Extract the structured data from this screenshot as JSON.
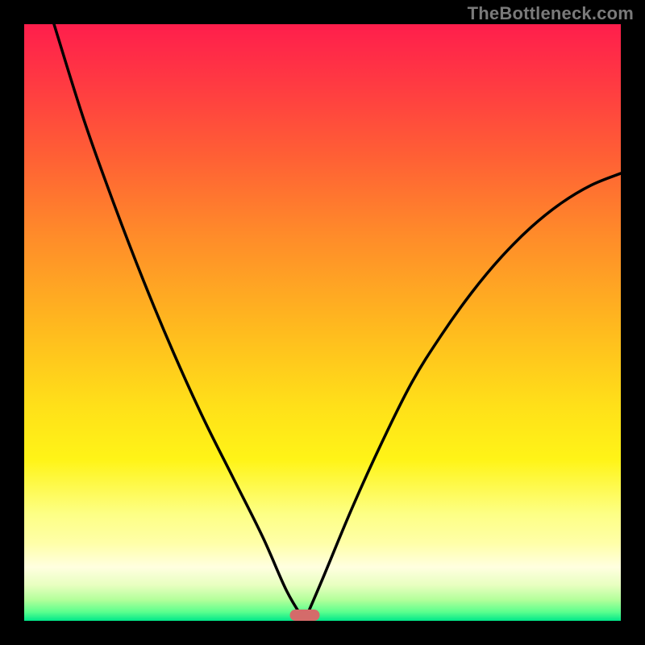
{
  "watermark": "TheBottleneck.com",
  "colors": {
    "frame": "#000000",
    "curve": "#000000",
    "marker": "#d46b6a",
    "gradient_stops": [
      "#ff1e4c",
      "#ff3a42",
      "#ff5f35",
      "#ff8a2a",
      "#ffb71f",
      "#ffe019",
      "#fff417",
      "#fdff84",
      "#ffffa8",
      "#ffffe0",
      "#e8ffc0",
      "#b2ff9a",
      "#5cff8e",
      "#00e78a"
    ]
  },
  "chart_data": {
    "type": "line",
    "title": "",
    "xlabel": "",
    "ylabel": "",
    "xlim": [
      0,
      100
    ],
    "ylim": [
      0,
      100
    ],
    "grid": false,
    "marker": {
      "x": 47,
      "width": 5
    },
    "series": [
      {
        "name": "left-curve",
        "x": [
          5,
          10,
          15,
          20,
          25,
          30,
          35,
          40,
          44,
          47
        ],
        "values": [
          100,
          84,
          70,
          57,
          45,
          34,
          24,
          14,
          5,
          0
        ]
      },
      {
        "name": "right-curve",
        "x": [
          47,
          50,
          55,
          60,
          65,
          70,
          75,
          80,
          85,
          90,
          95,
          100
        ],
        "values": [
          0,
          7,
          19,
          30,
          40,
          48,
          55,
          61,
          66,
          70,
          73,
          75
        ]
      }
    ]
  }
}
